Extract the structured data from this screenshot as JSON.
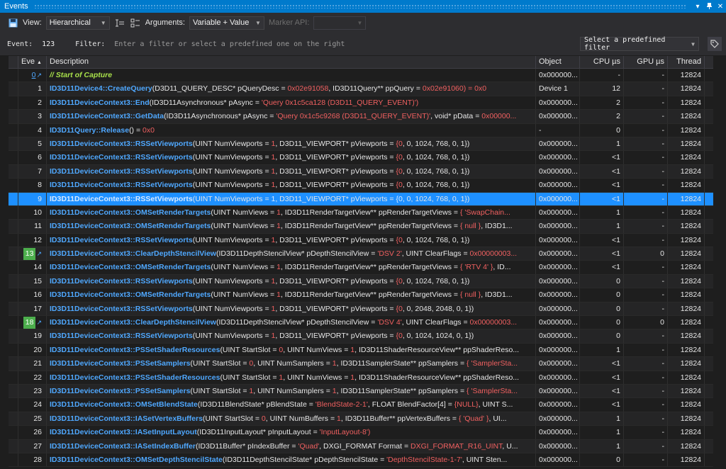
{
  "window": {
    "title": "Events",
    "pin_glyph": "▾",
    "dock_glyph": "↕",
    "close_glyph": "✕"
  },
  "toolbar": {
    "view_label": "View:",
    "view_value": "Hierarchical",
    "arguments_label": "Arguments:",
    "arguments_value": "Variable + Value",
    "marker_api_label": "Marker API:",
    "marker_api_value": ""
  },
  "filterbar": {
    "event_label": "Event:",
    "event_value": "123",
    "filter_label": "Filter:",
    "filter_placeholder": "Enter a filter or select a predefined one on the right",
    "predefined_label": "Select a predefined filter"
  },
  "columns": {
    "event": "Eve",
    "description": "Description",
    "object": "Object",
    "cpu": "CPU µs",
    "gpu": "GPU µs",
    "thread": "Thread"
  },
  "rows": [
    {
      "id": "0",
      "fn": "// Start of Capture",
      "args": "",
      "object": "0x000000...",
      "cpu": "-",
      "gpu": "-",
      "thread": "12824",
      "comment": true,
      "link": true
    },
    {
      "id": "1",
      "fn": "ID3D11Device4::CreateQuery",
      "args": "(D3D11_QUERY_DESC* pQueryDesc = 0x02e91058, ID3D11Query** ppQuery = 0x02e91060) = 0x0",
      "object": "Device 1",
      "cpu": "12",
      "gpu": "-",
      "thread": "12824"
    },
    {
      "id": "2",
      "fn": "ID3D11DeviceContext3::End",
      "args": "(ID3D11Asynchronous* pAsync = 'Query 0x1c5ca128 (D3D11_QUERY_EVENT)')",
      "object": "0x000000...",
      "cpu": "2",
      "gpu": "-",
      "thread": "12824"
    },
    {
      "id": "3",
      "fn": "ID3D11DeviceContext3::GetData",
      "args": "(ID3D11Asynchronous* pAsync = 'Query 0x1c5c9268 (D3D11_QUERY_EVENT)', void* pData = 0x00000...",
      "object": "0x000000...",
      "cpu": "2",
      "gpu": "-",
      "thread": "12824"
    },
    {
      "id": "4",
      "fn": "ID3D11Query::Release",
      "args": "() = 0x0",
      "object": "-",
      "cpu": "0",
      "gpu": "-",
      "thread": "12824"
    },
    {
      "id": "5",
      "fn": "ID3D11DeviceContext3::RSSetViewports",
      "args": "(UINT NumViewports = 1, D3D11_VIEWPORT* pViewports = {0, 0, 1024, 768, 0, 1})",
      "object": "0x000000...",
      "cpu": "1",
      "gpu": "-",
      "thread": "12824"
    },
    {
      "id": "6",
      "fn": "ID3D11DeviceContext3::RSSetViewports",
      "args": "(UINT NumViewports = 1, D3D11_VIEWPORT* pViewports = {0, 0, 1024, 768, 0, 1})",
      "object": "0x000000...",
      "cpu": "<1",
      "gpu": "-",
      "thread": "12824"
    },
    {
      "id": "7",
      "fn": "ID3D11DeviceContext3::RSSetViewports",
      "args": "(UINT NumViewports = 1, D3D11_VIEWPORT* pViewports = {0, 0, 1024, 768, 0, 1})",
      "object": "0x000000...",
      "cpu": "<1",
      "gpu": "-",
      "thread": "12824"
    },
    {
      "id": "8",
      "fn": "ID3D11DeviceContext3::RSSetViewports",
      "args": "(UINT NumViewports = 1, D3D11_VIEWPORT* pViewports = {0, 0, 1024, 768, 0, 1})",
      "object": "0x000000...",
      "cpu": "<1",
      "gpu": "-",
      "thread": "12824"
    },
    {
      "id": "9",
      "fn": "ID3D11DeviceContext3::RSSetViewports",
      "args": "(UINT NumViewports = 1, D3D11_VIEWPORT* pViewports = {0, 0, 1024, 768, 0, 1})",
      "object": "0x000000...",
      "cpu": "<1",
      "gpu": "-",
      "thread": "12824",
      "selected": true
    },
    {
      "id": "10",
      "fn": "ID3D11DeviceContext3::OMSetRenderTargets",
      "args": "(UINT NumViews = 1, ID3D11RenderTargetView** ppRenderTargetViews = { 'SwapChain...",
      "object": "0x000000...",
      "cpu": "1",
      "gpu": "-",
      "thread": "12824"
    },
    {
      "id": "11",
      "fn": "ID3D11DeviceContext3::OMSetRenderTargets",
      "args": "(UINT NumViews = 1, ID3D11RenderTargetView** ppRenderTargetViews = { null }, ID3D1...",
      "object": "0x000000...",
      "cpu": "1",
      "gpu": "-",
      "thread": "12824"
    },
    {
      "id": "12",
      "fn": "ID3D11DeviceContext3::RSSetViewports",
      "args": "(UINT NumViewports = 1, D3D11_VIEWPORT* pViewports = {0, 0, 1024, 768, 0, 1})",
      "object": "0x000000...",
      "cpu": "<1",
      "gpu": "-",
      "thread": "12824"
    },
    {
      "id": "13",
      "fn": "ID3D11DeviceContext3::ClearDepthStencilView",
      "args": "(ID3D11DepthStencilView* pDepthStencilView = 'DSV 2', UINT ClearFlags = 0x00000003...",
      "object": "0x000000...",
      "cpu": "<1",
      "gpu": "0",
      "thread": "12824",
      "badge": true
    },
    {
      "id": "14",
      "fn": "ID3D11DeviceContext3::OMSetRenderTargets",
      "args": "(UINT NumViews = 1, ID3D11RenderTargetView** ppRenderTargetViews = { 'RTV 4' }, ID...",
      "object": "0x000000...",
      "cpu": "<1",
      "gpu": "-",
      "thread": "12824"
    },
    {
      "id": "15",
      "fn": "ID3D11DeviceContext3::RSSetViewports",
      "args": "(UINT NumViewports = 1, D3D11_VIEWPORT* pViewports = {0, 0, 1024, 768, 0, 1})",
      "object": "0x000000...",
      "cpu": "0",
      "gpu": "-",
      "thread": "12824"
    },
    {
      "id": "16",
      "fn": "ID3D11DeviceContext3::OMSetRenderTargets",
      "args": "(UINT NumViews = 1, ID3D11RenderTargetView** ppRenderTargetViews = { null }, ID3D1...",
      "object": "0x000000...",
      "cpu": "0",
      "gpu": "-",
      "thread": "12824"
    },
    {
      "id": "17",
      "fn": "ID3D11DeviceContext3::RSSetViewports",
      "args": "(UINT NumViewports = 1, D3D11_VIEWPORT* pViewports = {0, 0, 2048, 2048, 0, 1})",
      "object": "0x000000...",
      "cpu": "0",
      "gpu": "-",
      "thread": "12824"
    },
    {
      "id": "18",
      "fn": "ID3D11DeviceContext3::ClearDepthStencilView",
      "args": "(ID3D11DepthStencilView* pDepthStencilView = 'DSV 4', UINT ClearFlags = 0x00000003...",
      "object": "0x000000...",
      "cpu": "0",
      "gpu": "0",
      "thread": "12824",
      "badge": true
    },
    {
      "id": "19",
      "fn": "ID3D11DeviceContext3::RSSetViewports",
      "args": "(UINT NumViewports = 1, D3D11_VIEWPORT* pViewports = {0, 0, 1024, 1024, 0, 1})",
      "object": "0x000000...",
      "cpu": "0",
      "gpu": "-",
      "thread": "12824"
    },
    {
      "id": "20",
      "fn": "ID3D11DeviceContext3::PSSetShaderResources",
      "args": "(UINT StartSlot = 0, UINT NumViews = 1, ID3D11ShaderResourceView** ppShaderReso...",
      "object": "0x000000...",
      "cpu": "1",
      "gpu": "-",
      "thread": "12824"
    },
    {
      "id": "21",
      "fn": "ID3D11DeviceContext3::PSSetSamplers",
      "args": "(UINT StartSlot = 0, UINT NumSamplers = 1, ID3D11SamplerState** ppSamplers = { 'SamplerSta...",
      "object": "0x000000...",
      "cpu": "<1",
      "gpu": "-",
      "thread": "12824"
    },
    {
      "id": "22",
      "fn": "ID3D11DeviceContext3::PSSetShaderResources",
      "args": "(UINT StartSlot = 1, UINT NumViews = 1, ID3D11ShaderResourceView** ppShaderReso...",
      "object": "0x000000...",
      "cpu": "<1",
      "gpu": "-",
      "thread": "12824"
    },
    {
      "id": "23",
      "fn": "ID3D11DeviceContext3::PSSetSamplers",
      "args": "(UINT StartSlot = 1, UINT NumSamplers = 1, ID3D11SamplerState** ppSamplers = { 'SamplerSta...",
      "object": "0x000000...",
      "cpu": "<1",
      "gpu": "-",
      "thread": "12824"
    },
    {
      "id": "24",
      "fn": "ID3D11DeviceContext3::OMSetBlendState",
      "args": "(ID3D11BlendState* pBlendState = 'BlendState-2-1', FLOAT BlendFactor[4] = {NULL}, UINT S...",
      "object": "0x000000...",
      "cpu": "<1",
      "gpu": "-",
      "thread": "12824"
    },
    {
      "id": "25",
      "fn": "ID3D11DeviceContext3::IASetVertexBuffers",
      "args": "(UINT StartSlot = 0, UINT NumBuffers = 1, ID3D11Buffer** ppVertexBuffers = { 'Quad' }, UI...",
      "object": "0x000000...",
      "cpu": "1",
      "gpu": "-",
      "thread": "12824"
    },
    {
      "id": "26",
      "fn": "ID3D11DeviceContext3::IASetInputLayout",
      "args": "(ID3D11InputLayout* pInputLayout = 'InputLayout-8')",
      "object": "0x000000...",
      "cpu": "1",
      "gpu": "-",
      "thread": "12824"
    },
    {
      "id": "27",
      "fn": "ID3D11DeviceContext3::IASetIndexBuffer",
      "args": "(ID3D11Buffer* pIndexBuffer = 'Quad', DXGI_FORMAT Format = DXGI_FORMAT_R16_UINT, U...",
      "object": "0x000000...",
      "cpu": "1",
      "gpu": "-",
      "thread": "12824"
    },
    {
      "id": "28",
      "fn": "ID3D11DeviceContext3::OMSetDepthStencilState",
      "args": "(ID3D11DepthStencilState* pDepthStencilState = 'DepthStencilState-1-7', UINT Sten...",
      "object": "0x000000...",
      "cpu": "0",
      "gpu": "-",
      "thread": "12824"
    }
  ],
  "colors": {
    "accent": "#007acc",
    "function": "#4fa8ff",
    "value": "#f06060",
    "comment": "#a8e04a",
    "badge": "#4cae4c",
    "selection": "#1e90ff"
  }
}
